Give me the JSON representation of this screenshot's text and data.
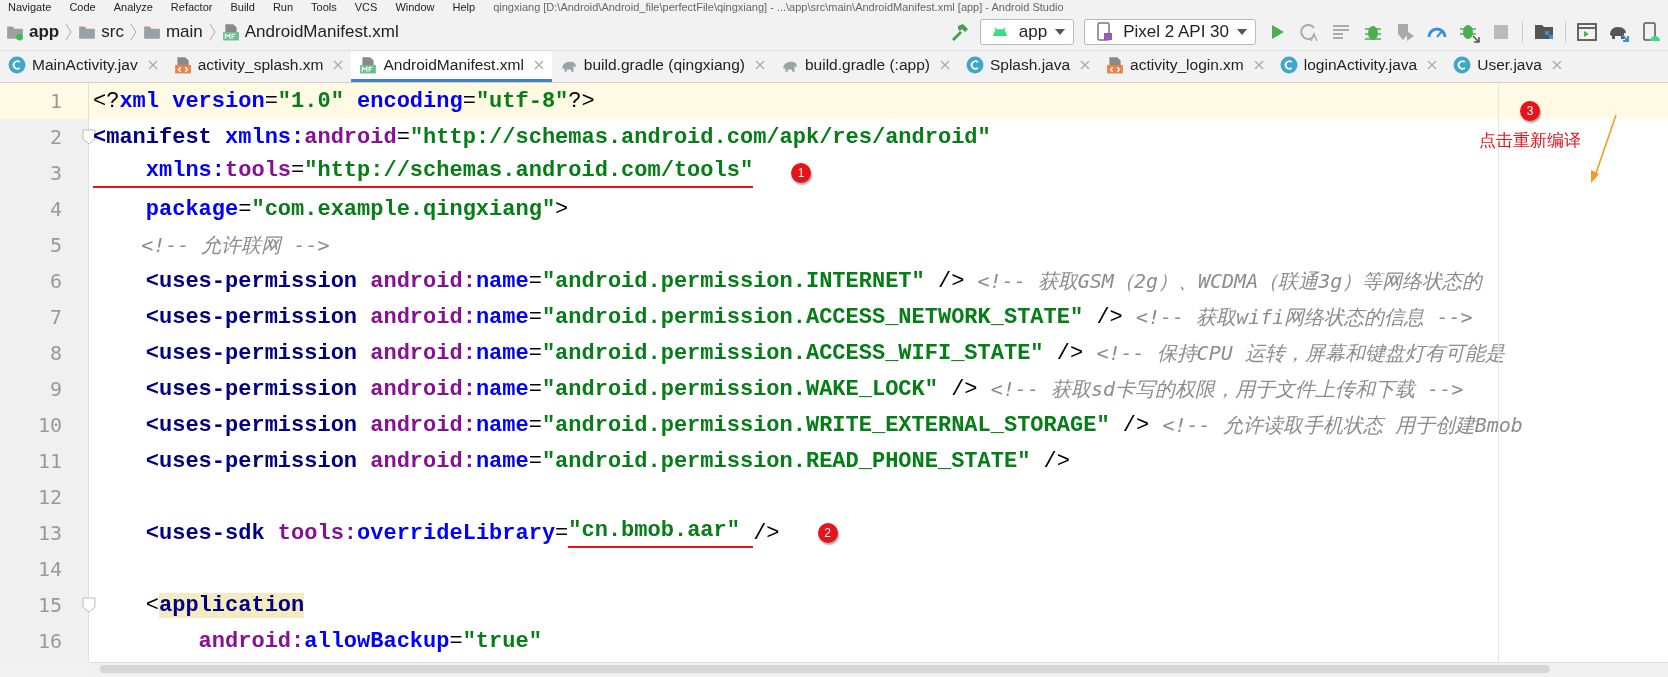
{
  "menu": {
    "items": [
      "Navigate",
      "Code",
      "Analyze",
      "Refactor",
      "Build",
      "Run",
      "Tools",
      "VCS",
      "Window",
      "Help"
    ],
    "title": "qingxiang [D:\\Android\\Android_file\\perfectFile\\qingxiang] - ...\\app\\src\\main\\AndroidManifest.xml [app] - Android Studio"
  },
  "breadcrumb": [
    {
      "label": "app",
      "kind": "module"
    },
    {
      "label": "src",
      "kind": "folder"
    },
    {
      "label": "main",
      "kind": "folder"
    },
    {
      "label": "AndroidManifest.xml",
      "kind": "manifest"
    }
  ],
  "toolbar": {
    "configuration": "app",
    "device": "Pixel 2 API 30"
  },
  "tabs": [
    {
      "label": "MainActivity.jav",
      "kind": "class",
      "selected": false
    },
    {
      "label": "activity_splash.xm",
      "kind": "layout",
      "selected": false
    },
    {
      "label": "AndroidManifest.xml",
      "kind": "manifest",
      "selected": true
    },
    {
      "label": "build.gradle (qingxiang)",
      "kind": "gradle",
      "selected": false
    },
    {
      "label": "build.gradle (:app)",
      "kind": "gradle",
      "selected": false
    },
    {
      "label": "Splash.java",
      "kind": "class",
      "selected": false
    },
    {
      "label": "activity_login.xm",
      "kind": "layout",
      "selected": false
    },
    {
      "label": "loginActivity.java",
      "kind": "class",
      "selected": false
    },
    {
      "label": "User.java",
      "kind": "class",
      "selected": false
    }
  ],
  "editor": {
    "lines": [
      {
        "number": "1",
        "current": true,
        "fold": false,
        "segments": [
          {
            "kind": "punct",
            "text": "<?"
          },
          {
            "kind": "attr",
            "text": "xml version"
          },
          {
            "kind": "punct",
            "text": "="
          },
          {
            "kind": "value",
            "text": "\"1.0\""
          },
          {
            "kind": "attr",
            "text": " encoding"
          },
          {
            "kind": "punct",
            "text": "="
          },
          {
            "kind": "value",
            "text": "\"utf-8\""
          },
          {
            "kind": "punct",
            "text": "?>"
          }
        ]
      },
      {
        "number": "2",
        "current": false,
        "fold": true,
        "segments": [
          {
            "kind": "tag",
            "text": "<manifest "
          },
          {
            "kind": "attr",
            "text": "xmlns:"
          },
          {
            "kind": "ns",
            "text": "android"
          },
          {
            "kind": "punct",
            "text": "="
          },
          {
            "kind": "value",
            "text": "\"http://schemas.android.com/apk/res/android\""
          }
        ]
      },
      {
        "number": "3",
        "current": false,
        "fold": false,
        "marker": "1",
        "segments": [
          {
            "kind": "attr",
            "text": "    xmlns:",
            "underlined": true
          },
          {
            "kind": "ns",
            "text": "tools",
            "underlined": true
          },
          {
            "kind": "punct",
            "text": "=",
            "underlined": true
          },
          {
            "kind": "value",
            "text": "\"http://schemas.android.com/tools\"",
            "underlined": true
          }
        ]
      },
      {
        "number": "4",
        "current": false,
        "fold": false,
        "segments": [
          {
            "kind": "attr",
            "text": "    package"
          },
          {
            "kind": "punct",
            "text": "="
          },
          {
            "kind": "value",
            "text": "\"com.example.qingxiang\""
          },
          {
            "kind": "punct",
            "text": ">"
          }
        ]
      },
      {
        "number": "5",
        "current": false,
        "fold": false,
        "segments": [
          {
            "kind": "comment",
            "text": "    <!-- 允许联网 -->"
          }
        ]
      },
      {
        "number": "6",
        "current": false,
        "fold": false,
        "segments": [
          {
            "kind": "tag",
            "text": "    <uses-permission "
          },
          {
            "kind": "ns",
            "text": "android:"
          },
          {
            "kind": "attr",
            "text": "name"
          },
          {
            "kind": "punct",
            "text": "="
          },
          {
            "kind": "value",
            "text": "\"android.permission.INTERNET\""
          },
          {
            "kind": "punct",
            "text": " /> "
          },
          {
            "kind": "comment",
            "text": "<!-- 获取GSM（2g）、WCDMA（联通3g）等网络状态的"
          }
        ]
      },
      {
        "number": "7",
        "current": false,
        "fold": false,
        "segments": [
          {
            "kind": "tag",
            "text": "    <uses-permission "
          },
          {
            "kind": "ns",
            "text": "android:"
          },
          {
            "kind": "attr",
            "text": "name"
          },
          {
            "kind": "punct",
            "text": "="
          },
          {
            "kind": "value",
            "text": "\"android.permission.ACCESS_NETWORK_STATE\""
          },
          {
            "kind": "punct",
            "text": " /> "
          },
          {
            "kind": "comment",
            "text": "<!-- 获取wifi网络状态的信息 -->"
          }
        ]
      },
      {
        "number": "8",
        "current": false,
        "fold": false,
        "segments": [
          {
            "kind": "tag",
            "text": "    <uses-permission "
          },
          {
            "kind": "ns",
            "text": "android:"
          },
          {
            "kind": "attr",
            "text": "name"
          },
          {
            "kind": "punct",
            "text": "="
          },
          {
            "kind": "value",
            "text": "\"android.permission.ACCESS_WIFI_STATE\""
          },
          {
            "kind": "punct",
            "text": " /> "
          },
          {
            "kind": "comment",
            "text": "<!-- 保持CPU 运转，屏幕和键盘灯有可能是"
          }
        ]
      },
      {
        "number": "9",
        "current": false,
        "fold": false,
        "segments": [
          {
            "kind": "tag",
            "text": "    <uses-permission "
          },
          {
            "kind": "ns",
            "text": "android:"
          },
          {
            "kind": "attr",
            "text": "name"
          },
          {
            "kind": "punct",
            "text": "="
          },
          {
            "kind": "value",
            "text": "\"android.permission.WAKE_LOCK\""
          },
          {
            "kind": "punct",
            "text": " /> "
          },
          {
            "kind": "comment",
            "text": "<!-- 获取sd卡写的权限，用于文件上传和下载 -->"
          }
        ]
      },
      {
        "number": "10",
        "current": false,
        "fold": false,
        "segments": [
          {
            "kind": "tag",
            "text": "    <uses-permission "
          },
          {
            "kind": "ns",
            "text": "android:"
          },
          {
            "kind": "attr",
            "text": "name"
          },
          {
            "kind": "punct",
            "text": "="
          },
          {
            "kind": "value",
            "text": "\"android.permission.WRITE_EXTERNAL_STORAGE\""
          },
          {
            "kind": "punct",
            "text": " /> "
          },
          {
            "kind": "comment",
            "text": "<!-- 允许读取手机状态 用于创建Bmob"
          }
        ]
      },
      {
        "number": "11",
        "current": false,
        "fold": false,
        "segments": [
          {
            "kind": "tag",
            "text": "    <uses-permission "
          },
          {
            "kind": "ns",
            "text": "android:"
          },
          {
            "kind": "attr",
            "text": "name"
          },
          {
            "kind": "punct",
            "text": "="
          },
          {
            "kind": "value",
            "text": "\"android.permission.READ_PHONE_STATE\""
          },
          {
            "kind": "punct",
            "text": " />"
          }
        ]
      },
      {
        "number": "12",
        "current": false,
        "fold": false
      },
      {
        "number": "13",
        "current": false,
        "fold": false,
        "marker": "2",
        "segments": [
          {
            "kind": "tag",
            "text": "    <uses-sdk "
          },
          {
            "kind": "ns",
            "text": "tools:"
          },
          {
            "kind": "attr",
            "text": "overrideLibrary"
          },
          {
            "kind": "punct",
            "text": "="
          },
          {
            "kind": "value",
            "text": "\"cn.bmob.aar\" ",
            "underlined": true
          },
          {
            "kind": "punct",
            "text": "/>"
          }
        ]
      },
      {
        "number": "14",
        "current": false,
        "fold": false
      },
      {
        "number": "15",
        "current": false,
        "fold": true,
        "segments": [
          {
            "kind": "punct",
            "text": "    <"
          },
          {
            "kind": "tag-match",
            "text": "application"
          }
        ]
      },
      {
        "number": "16",
        "current": false,
        "fold": false,
        "segments": [
          {
            "kind": "ns",
            "text": "        android:"
          },
          {
            "kind": "attr",
            "text": "allowBackup"
          },
          {
            "kind": "punct",
            "text": "="
          },
          {
            "kind": "value",
            "text": "\"true\""
          }
        ]
      }
    ]
  },
  "note": {
    "marker": "3",
    "text": "点击重新编译"
  }
}
